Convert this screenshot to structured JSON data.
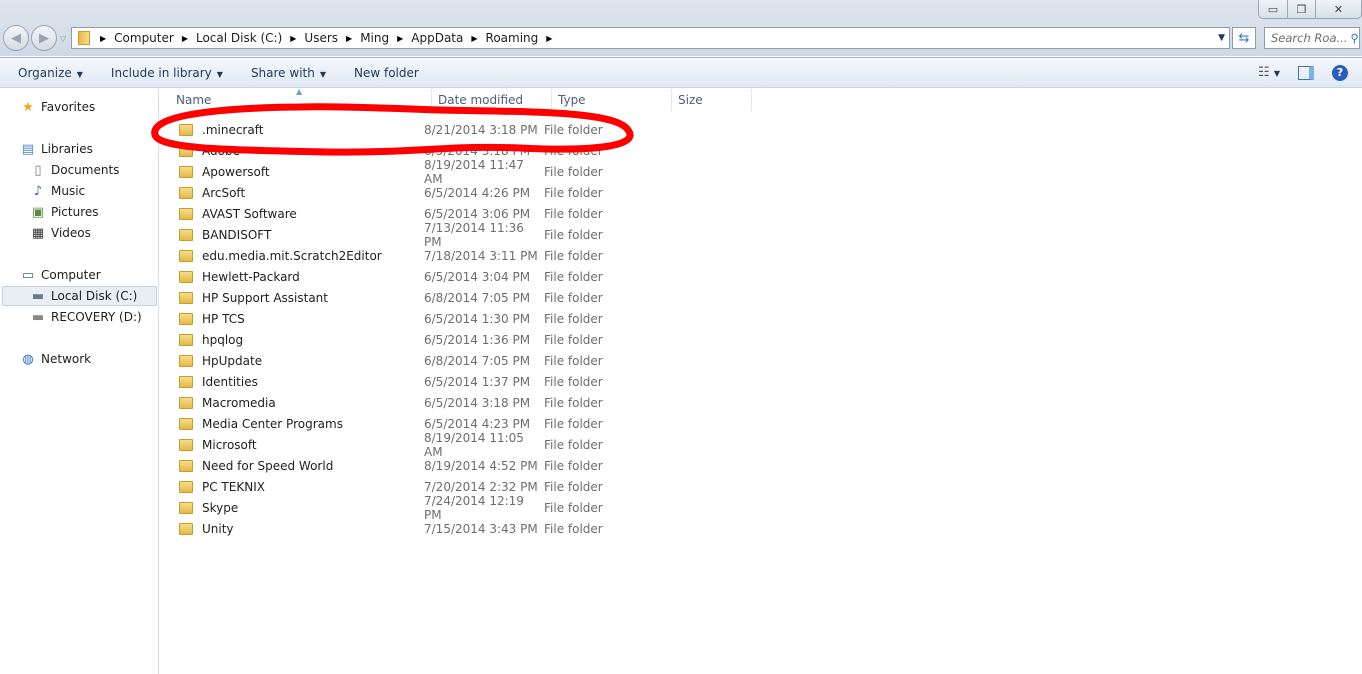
{
  "window": {
    "minimize": "▭",
    "restore": "❐",
    "close": "✕"
  },
  "address": {
    "crumbs": [
      "Computer",
      "Local Disk (C:)",
      "Users",
      "Ming",
      "AppData",
      "Roaming"
    ]
  },
  "search": {
    "placeholder": "Search Roa..."
  },
  "toolbar": {
    "organize": "Organize",
    "include": "Include in library",
    "share": "Share with",
    "new_folder": "New folder"
  },
  "sidebar": {
    "favorites": "Favorites",
    "libraries": "Libraries",
    "documents": "Documents",
    "music": "Music",
    "pictures": "Pictures",
    "videos": "Videos",
    "computer": "Computer",
    "local_disk": "Local Disk (C:)",
    "recovery": "RECOVERY (D:)",
    "network": "Network"
  },
  "columns": {
    "name": "Name",
    "date": "Date modified",
    "type": "Type",
    "size": "Size"
  },
  "files": [
    {
      "name": ".minecraft",
      "date": "8/21/2014 3:18 PM",
      "type": "File folder"
    },
    {
      "name": "Adobe",
      "date": "6/5/2014 3:18 PM",
      "type": "File folder"
    },
    {
      "name": "Apowersoft",
      "date": "8/19/2014 11:47 AM",
      "type": "File folder"
    },
    {
      "name": "ArcSoft",
      "date": "6/5/2014 4:26 PM",
      "type": "File folder"
    },
    {
      "name": "AVAST Software",
      "date": "6/5/2014 3:06 PM",
      "type": "File folder"
    },
    {
      "name": "BANDISOFT",
      "date": "7/13/2014 11:36 PM",
      "type": "File folder"
    },
    {
      "name": "edu.media.mit.Scratch2Editor",
      "date": "7/18/2014 3:11 PM",
      "type": "File folder"
    },
    {
      "name": "Hewlett-Packard",
      "date": "6/5/2014 3:04 PM",
      "type": "File folder"
    },
    {
      "name": "HP Support Assistant",
      "date": "6/8/2014 7:05 PM",
      "type": "File folder"
    },
    {
      "name": "HP TCS",
      "date": "6/5/2014 1:30 PM",
      "type": "File folder"
    },
    {
      "name": "hpqlog",
      "date": "6/5/2014 1:36 PM",
      "type": "File folder"
    },
    {
      "name": "HpUpdate",
      "date": "6/8/2014 7:05 PM",
      "type": "File folder"
    },
    {
      "name": "Identities",
      "date": "6/5/2014 1:37 PM",
      "type": "File folder"
    },
    {
      "name": "Macromedia",
      "date": "6/5/2014 3:18 PM",
      "type": "File folder"
    },
    {
      "name": "Media Center Programs",
      "date": "6/5/2014 4:23 PM",
      "type": "File folder"
    },
    {
      "name": "Microsoft",
      "date": "8/19/2014 11:05 AM",
      "type": "File folder"
    },
    {
      "name": "Need for Speed World",
      "date": "8/19/2014 4:52 PM",
      "type": "File folder"
    },
    {
      "name": "PC TEKNIX",
      "date": "7/20/2014 2:32 PM",
      "type": "File folder"
    },
    {
      "name": "Skype",
      "date": "7/24/2014 12:19 PM",
      "type": "File folder"
    },
    {
      "name": "Unity",
      "date": "7/15/2014 3:43 PM",
      "type": "File folder"
    }
  ]
}
